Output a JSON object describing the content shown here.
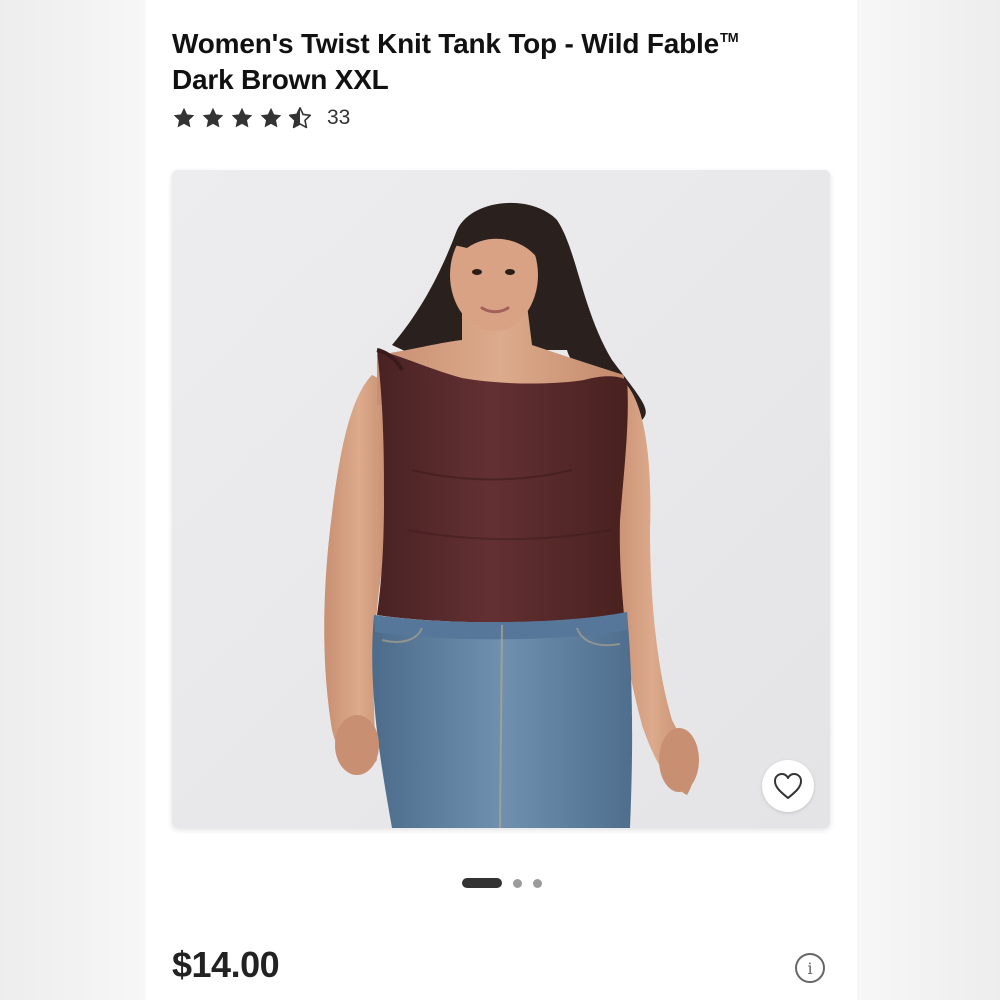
{
  "product": {
    "title_line1": "Women's Twist Knit Tank Top - Wild Fable",
    "trademark": "TM",
    "title_line2": "Dark Brown XXL",
    "rating": 4.5,
    "rating_max": 5,
    "review_count": "33",
    "price": "$14.00"
  },
  "gallery": {
    "image_count": 3,
    "active_index": 0,
    "favorite_icon": "heart-outline-icon",
    "info_icon": "info-icon",
    "info_glyph": "i"
  },
  "colors": {
    "star": "#333333",
    "top_fabric": "#5a2a2b",
    "denim": "#5c7c9c",
    "photo_bg": "#e9e9eb"
  }
}
